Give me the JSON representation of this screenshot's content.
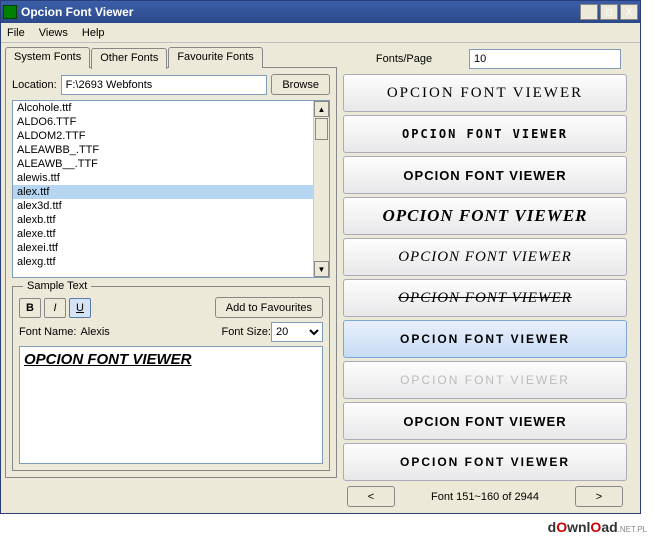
{
  "window": {
    "title": "Opcion Font Viewer"
  },
  "menu": {
    "file": "File",
    "views": "Views",
    "help": "Help"
  },
  "tabs": {
    "system": "System Fonts",
    "other": "Other Fonts",
    "favourite": "Favourite Fonts"
  },
  "location": {
    "label": "Location:",
    "value": "F:\\2693 Webfonts",
    "browse": "Browse"
  },
  "fontlist": {
    "items": [
      "Alcohole.ttf",
      "ALDO6.TTF",
      "ALDOM2.TTF",
      "ALEAWBB_.TTF",
      "ALEAWB__.TTF",
      "alewis.ttf",
      "alex.ttf",
      "alex3d.ttf",
      "alexb.ttf",
      "alexe.ttf",
      "alexei.ttf",
      "alexg.ttf"
    ],
    "selected": 6
  },
  "sample": {
    "legend": "Sample Text",
    "bold": "B",
    "italic": "I",
    "underline": "U",
    "add_fav": "Add to Favourites",
    "fontname_label": "Font Name:",
    "fontname_value": "Alexis",
    "fontsize_label": "Font Size:",
    "fontsize_value": "20",
    "text": "OPCION FONT VIEWER"
  },
  "fpp": {
    "label": "Fonts/Page",
    "value": "10"
  },
  "previews": {
    "text": "OPCION FONT VIEWER",
    "selected": 6
  },
  "pager": {
    "prev": "<",
    "next": ">",
    "info": "Font 151~160 of 2944"
  },
  "watermark": {
    "brand": "dOwnlOad",
    "tld": ".NET.PL"
  },
  "titlebuttons": {
    "min": "_",
    "max": "□",
    "close": "X"
  }
}
